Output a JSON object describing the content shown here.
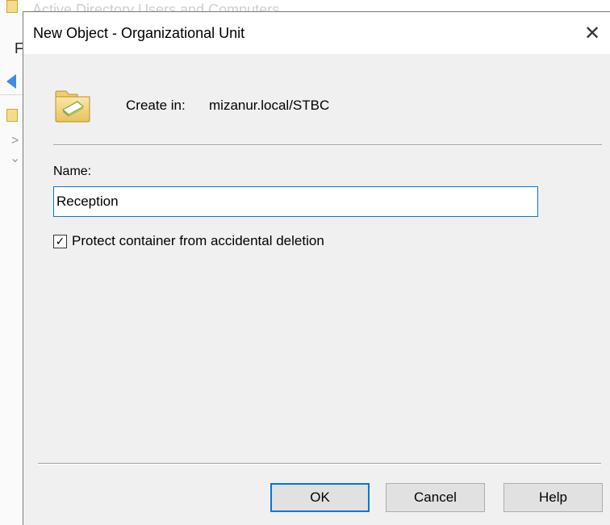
{
  "background": {
    "window_title": "Active Directory Users and Computers",
    "menu_letter": "F",
    "chevrons": [
      ">",
      "⌄"
    ]
  },
  "dialog": {
    "title": "New Object - Organizational Unit",
    "close_glyph": "✕",
    "create_in_label": "Create in:",
    "create_in_value": "mizanur.local/STBC",
    "name_label": "Name:",
    "name_value": "Reception",
    "protect_checkbox": {
      "label": "Protect container from accidental deletion",
      "checked": true,
      "glyph": "✓"
    },
    "buttons": {
      "ok": "OK",
      "cancel": "Cancel",
      "help": "Help"
    }
  },
  "icons": {
    "folder": "organizational-unit-folder-icon",
    "back": "back-arrow-icon"
  },
  "colors": {
    "accent": "#0078d7",
    "dialog_bg": "#f0f0f0",
    "folder_fill": "#f4d77c",
    "arrow_blue": "#3b8de0"
  }
}
